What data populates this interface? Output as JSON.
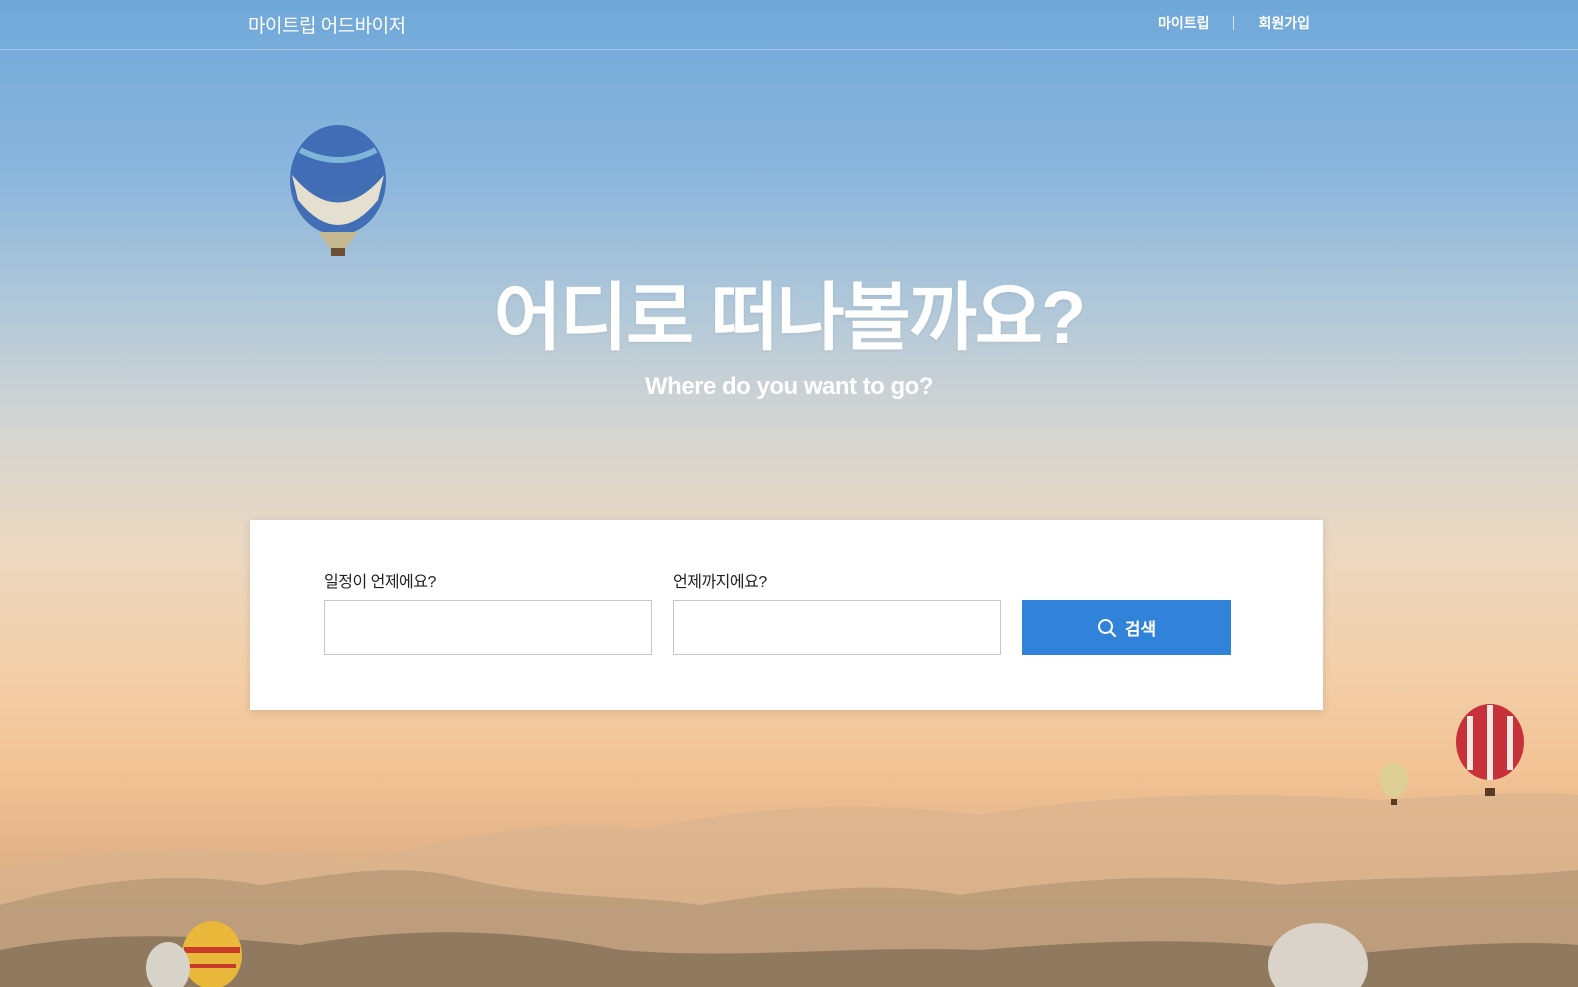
{
  "header": {
    "brand": "마이트립 어드바이저",
    "nav": [
      "마이트립",
      "회원가입"
    ]
  },
  "hero": {
    "title": "어디로 떠나볼까요?",
    "subtitle": "Where do you want to go?"
  },
  "search": {
    "start_label": "일정이 언제에요?",
    "start_value": "",
    "end_label": "언제까지에요?",
    "end_value": "",
    "button_label": "검색",
    "button_icon": "search-icon"
  },
  "colors": {
    "accent": "#3182d9"
  }
}
